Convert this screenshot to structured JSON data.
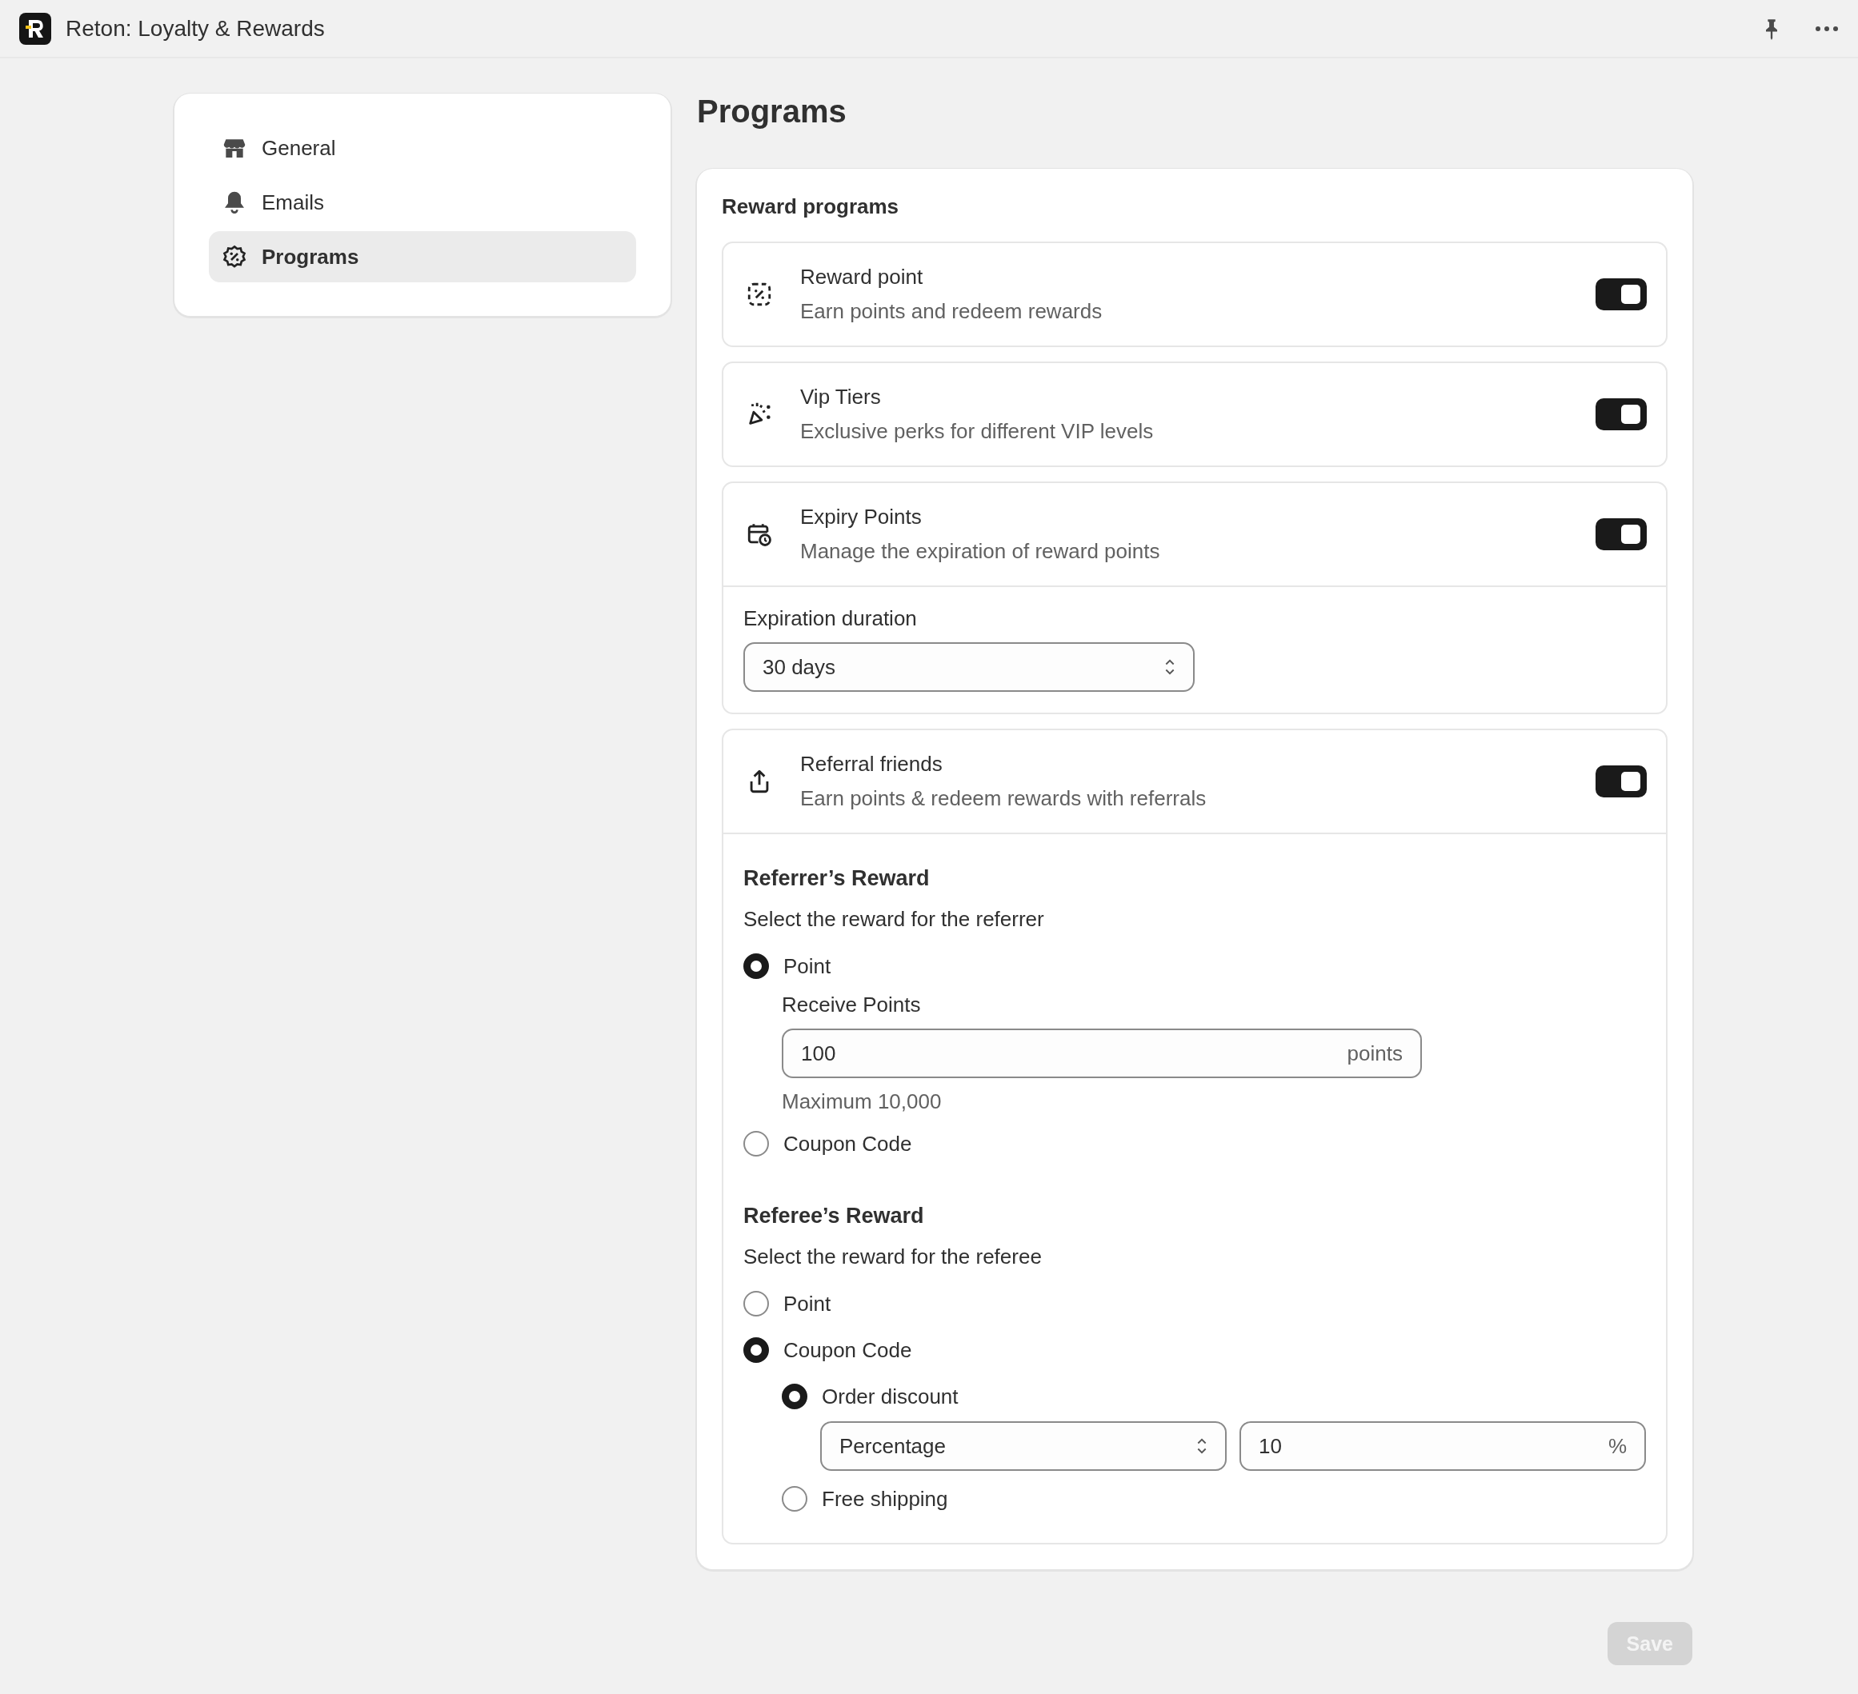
{
  "app": {
    "title": "Reton: Loyalty & Rewards"
  },
  "sidebar": {
    "items": [
      {
        "label": "General",
        "selected": false
      },
      {
        "label": "Emails",
        "selected": false
      },
      {
        "label": "Programs",
        "selected": true
      }
    ]
  },
  "page": {
    "title": "Programs"
  },
  "card": {
    "title": "Reward programs"
  },
  "programs": [
    {
      "kind": "plain",
      "title": "Reward point",
      "description": "Earn points and redeem rewards",
      "enabled": true
    },
    {
      "kind": "plain",
      "title": "Vip Tiers",
      "description": "Exclusive perks for different VIP levels",
      "enabled": true
    },
    {
      "kind": "expiry",
      "title": "Expiry Points",
      "description": "Manage the expiration of reward points",
      "enabled": true,
      "setting": {
        "label": "Expiration duration",
        "value": "30 days"
      }
    },
    {
      "kind": "referral",
      "title": "Referral friends",
      "description": "Earn points & redeem rewards with referrals",
      "enabled": true,
      "sections": [
        {
          "heading": "Referrer’s Reward",
          "prompt": "Select the reward for the referrer",
          "options": [
            {
              "label": "Point",
              "selected": true,
              "field": {
                "label": "Receive Points",
                "value": "100",
                "suffix": "points",
                "help": "Maximum 10,000"
              }
            },
            {
              "label": "Coupon Code",
              "selected": false
            }
          ]
        },
        {
          "heading": "Referee’s Reward",
          "prompt": "Select the reward for the referee",
          "options": [
            {
              "label": "Point",
              "selected": false
            },
            {
              "label": "Coupon Code",
              "selected": true,
              "suboptions": [
                {
                  "label": "Order discount",
                  "selected": true,
                  "discount": {
                    "type": "Percentage",
                    "value": "10",
                    "suffix": "%"
                  }
                },
                {
                  "label": "Free shipping",
                  "selected": false
                }
              ]
            }
          ]
        }
      ]
    }
  ],
  "save": {
    "label": "Save",
    "disabled": true
  }
}
